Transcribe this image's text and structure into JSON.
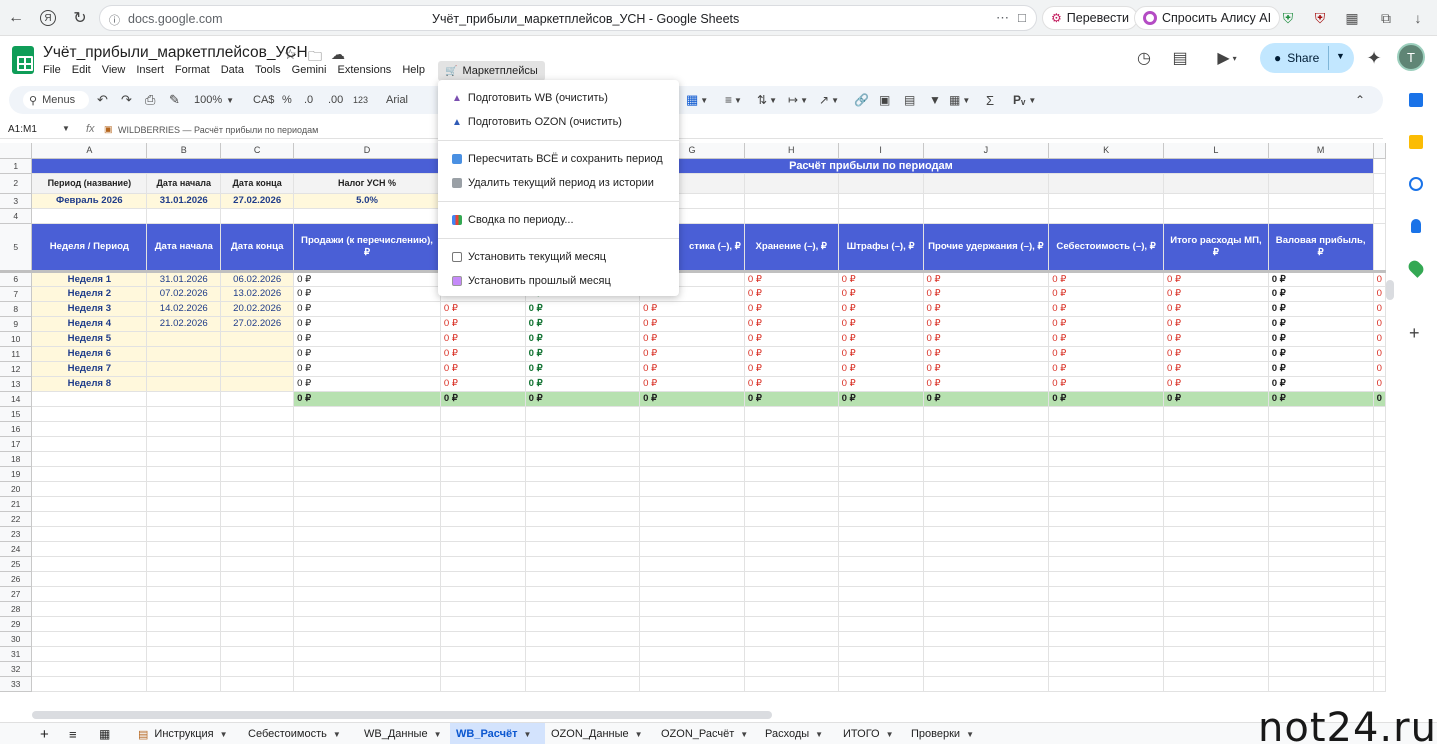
{
  "browser": {
    "url": "docs.google.com",
    "tab_title": "Учёт_прибыли_маркетплейсов_УСН - Google Sheets",
    "translate_label": "Перевести",
    "alice_label": "Спросить Алису AI"
  },
  "doc": {
    "title": "Учёт_прибыли_маркетплейсов_УСН",
    "menus": [
      "File",
      "Edit",
      "View",
      "Insert",
      "Format",
      "Data",
      "Tools",
      "Gemini",
      "Extensions",
      "Help"
    ],
    "custom_menu": "Маркетплейсы",
    "share_label": "Share",
    "avatar_letter": "T"
  },
  "toolbar": {
    "menus_label": "Menus",
    "zoom": "100%",
    "currency": "CA$",
    "percent": "%",
    "dec_minus": ".0",
    "dec_plus": ".00",
    "num_format": "123",
    "font": "Arial"
  },
  "formula_bar": {
    "name_box": "A1:M1",
    "fx": "fx",
    "content": "WILDBERRIES — Расчёт прибыли по периодам"
  },
  "grid": {
    "columns": [
      "A",
      "B",
      "C",
      "D",
      "E",
      "F",
      "G",
      "H",
      "I",
      "J",
      "K",
      "L",
      "M"
    ],
    "title_banner": "Расчёт прибыли по периодам",
    "period_headers": [
      "Период (название)",
      "Дата начала",
      "Дата конца",
      "Налог УСН %"
    ],
    "period_values": [
      "Февраль 2026",
      "31.01.2026",
      "27.02.2026",
      "5.0%"
    ],
    "header_row": {
      "A": "Неделя / Период",
      "B": "Дата начала",
      "C": "Дата конца",
      "D": "Продажи (к перечислению), ₽",
      "G": "стика (–), ₽",
      "H": "Хранение (–), ₽",
      "I": "Штрафы (–), ₽",
      "J": "Прочие удержания (–), ₽",
      "K": "Себестоимость (–), ₽",
      "L": "Итого расходы МП, ₽",
      "M": "Валовая прибыль, ₽"
    },
    "weeks": [
      {
        "name": "Неделя 1",
        "start": "31.01.2026",
        "end": "06.02.2026"
      },
      {
        "name": "Неделя 2",
        "start": "07.02.2026",
        "end": "13.02.2026"
      },
      {
        "name": "Неделя 3",
        "start": "14.02.2026",
        "end": "20.02.2026"
      },
      {
        "name": "Неделя 4",
        "start": "21.02.2026",
        "end": "27.02.2026"
      },
      {
        "name": "Неделя 5",
        "start": "",
        "end": ""
      },
      {
        "name": "Неделя 6",
        "start": "",
        "end": ""
      },
      {
        "name": "Неделя 7",
        "start": "",
        "end": ""
      },
      {
        "name": "Неделя 8",
        "start": "",
        "end": ""
      }
    ],
    "zero_value": "0 ₽",
    "partial_n": "0",
    "row_numbers": [
      "1",
      "2",
      "3",
      "4",
      "5",
      "6",
      "7",
      "8",
      "9",
      "10",
      "11",
      "12",
      "13",
      "14",
      "15",
      "16",
      "17",
      "18",
      "19",
      "20",
      "21",
      "22",
      "23",
      "24",
      "25",
      "26",
      "27",
      "28",
      "29",
      "30",
      "31",
      "32",
      "33"
    ]
  },
  "dropdown": {
    "items": [
      "Подготовить WB (очистить)",
      "Подготовить OZON (очистить)",
      "Пересчитать ВСЁ и сохранить период",
      "Удалить текущий период из истории",
      "Сводка по периоду...",
      "Установить текущий месяц",
      "Установить прошлый месяц"
    ]
  },
  "sheets": {
    "tabs": [
      {
        "label": "Инструкция"
      },
      {
        "label": "Себестоимость"
      },
      {
        "label": "WB_Данные"
      },
      {
        "label": "WB_Расчёт",
        "active": true
      },
      {
        "label": "OZON_Данные"
      },
      {
        "label": "OZON_Расчёт"
      },
      {
        "label": "Расходы"
      },
      {
        "label": "ИТОГО"
      },
      {
        "label": "Проверки"
      }
    ]
  },
  "watermark": "not24.ru",
  "colors": {
    "header_blue": "#4a5fd6",
    "input_yellow": "#fff8dc",
    "total_green": "#b7e1b0",
    "expense_red": "#d93025",
    "share_blue": "#c2e7ff",
    "sheets_green": "#0f9d58"
  }
}
